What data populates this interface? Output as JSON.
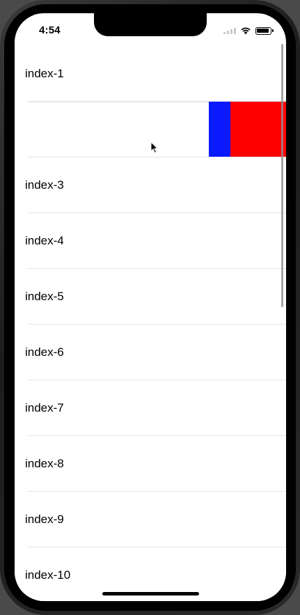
{
  "status_bar": {
    "time": "4:54"
  },
  "rows": [
    {
      "label": "index-1"
    },
    {
      "label": ""
    },
    {
      "label": "index-3"
    },
    {
      "label": "index-4"
    },
    {
      "label": "index-5"
    },
    {
      "label": "index-6"
    },
    {
      "label": "index-7"
    },
    {
      "label": "index-8"
    },
    {
      "label": "index-9"
    },
    {
      "label": "index-10"
    }
  ],
  "swipe_actions": {
    "row_index": 1,
    "action_colors": [
      "#0a1aff",
      "#ff0000"
    ]
  },
  "colors": {
    "separator": "#e5e5ea",
    "background": "#ffffff"
  }
}
